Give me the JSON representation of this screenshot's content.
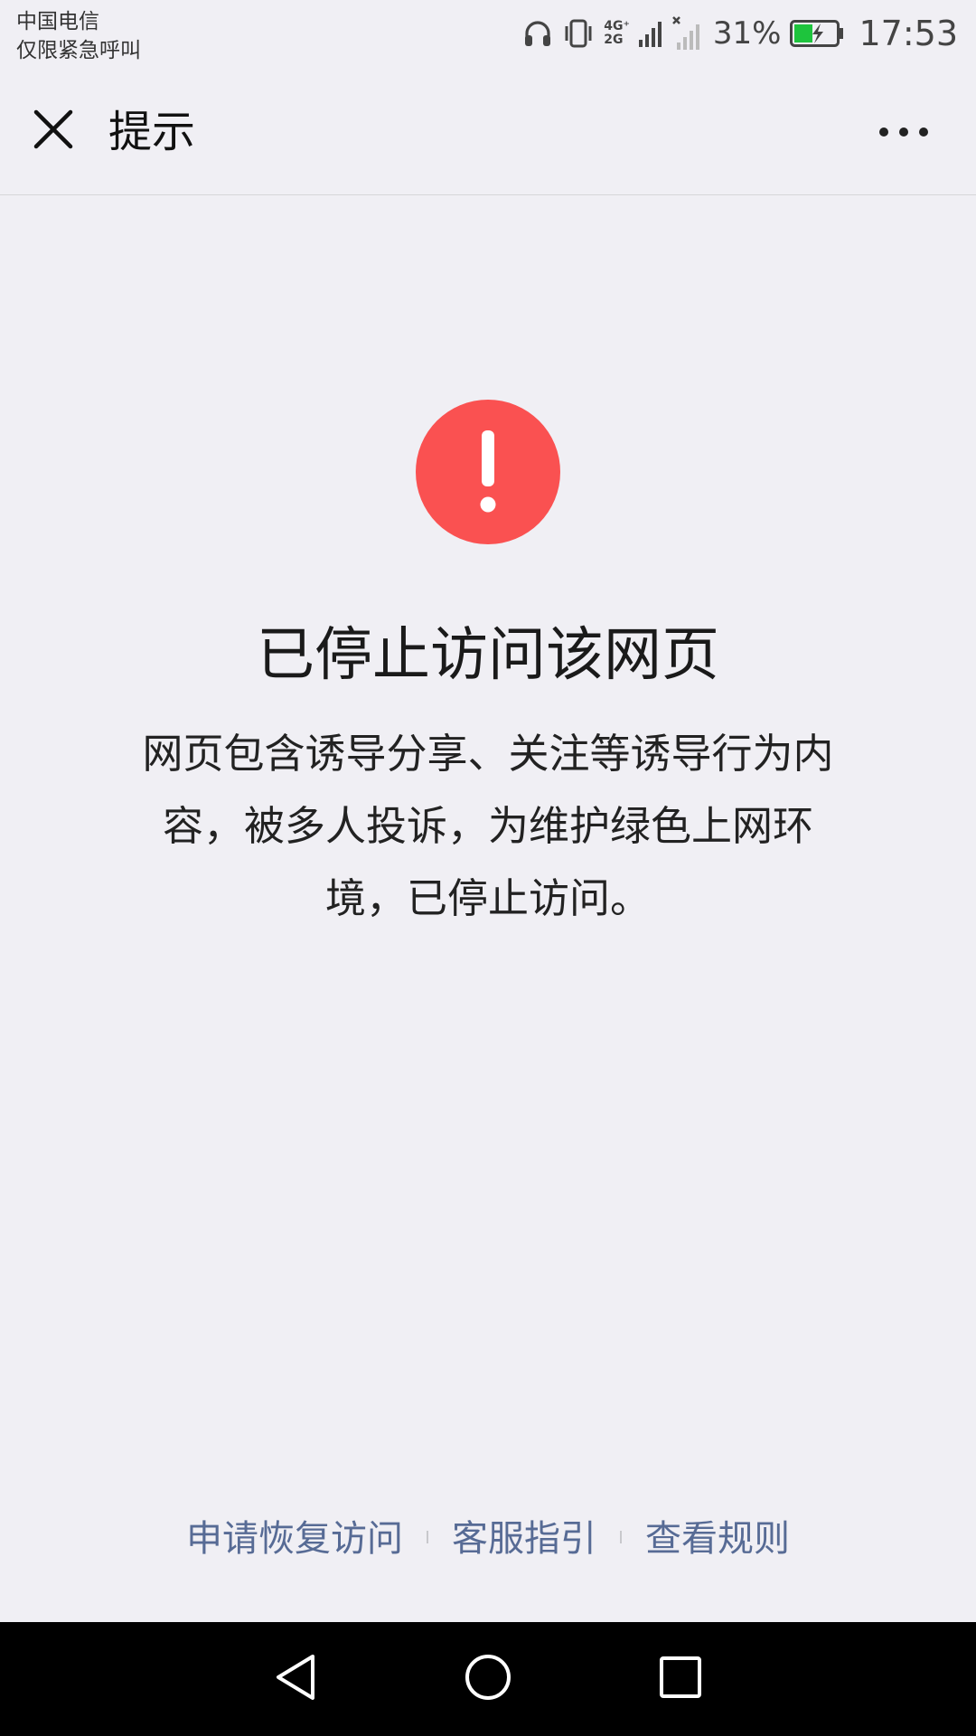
{
  "status_bar": {
    "carrier": "中国电信",
    "emergency": "仅限紧急呼叫",
    "net_top": "4G⁺",
    "net_bottom": "2G",
    "battery_percent": "31%",
    "time": "17:53",
    "battery_color": "#1ec43d",
    "icons": [
      "headphones-icon",
      "vibrate-icon",
      "signal-icon",
      "no-signal-icon",
      "battery-charging-icon"
    ]
  },
  "title_bar": {
    "title": "提示",
    "close_icon": "close-icon",
    "more_icon": "more-icon"
  },
  "main": {
    "icon": "warning-icon",
    "icon_color": "#fa5151",
    "headline": "已停止访问该网页",
    "message_lines": [
      "网页包含诱导分享、关注等诱导行为内",
      "容，被多人投诉，为维护绿色上网环",
      "境，已停止访问。"
    ]
  },
  "footer": {
    "links": [
      "申请恢复访问",
      "客服指引",
      "查看规则"
    ],
    "link_color": "#576b95"
  },
  "nav_bar": {
    "buttons": [
      "back-icon",
      "home-icon",
      "recents-icon"
    ]
  }
}
